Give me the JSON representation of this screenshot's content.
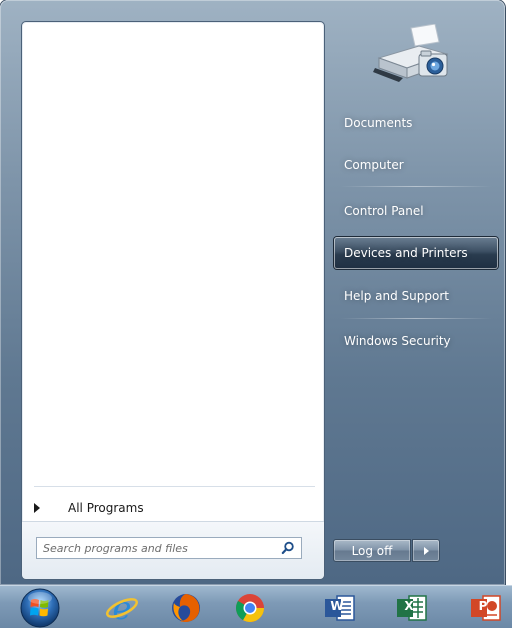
{
  "start_menu": {
    "left_pane": {
      "all_programs_label": "All Programs",
      "search": {
        "placeholder": "Search programs and files",
        "value": ""
      }
    },
    "right_pane": {
      "items": [
        {
          "label": "Documents",
          "selected": false
        },
        {
          "label": "Computer",
          "selected": false
        },
        {
          "label": "Control Panel",
          "selected": false
        },
        {
          "label": "Devices and Printers",
          "selected": true
        },
        {
          "label": "Help and Support",
          "selected": false
        },
        {
          "label": "Windows Security",
          "selected": false
        }
      ],
      "user_picture_icon": "printer-camera-icon"
    },
    "log_off_label": "Log off"
  },
  "taskbar": {
    "icons": [
      "windows-start-orb-icon",
      "internet-explorer-icon",
      "firefox-icon",
      "chrome-icon",
      "word-icon",
      "excel-icon",
      "powerpoint-icon"
    ],
    "word_letter": "W",
    "excel_letter": "X",
    "powerpoint_letter": "P"
  },
  "colors": {
    "menu_blue": "#6b8299",
    "selected_item": "#2a3c4f",
    "word_blue": "#2b579a",
    "excel_green": "#217346",
    "powerpoint_orange": "#d24726"
  }
}
